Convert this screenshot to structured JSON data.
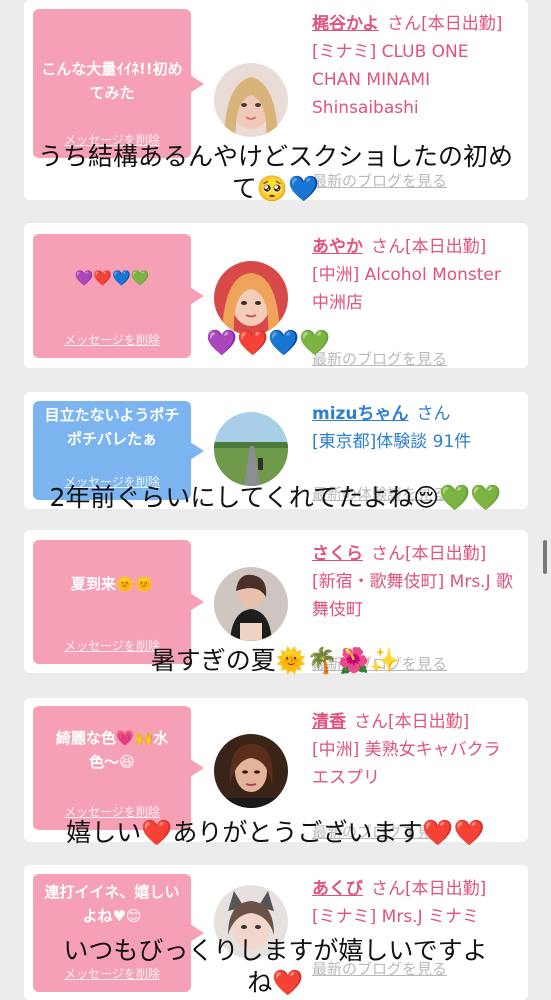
{
  "feed": {
    "delete_label": "メッセージを削除",
    "cards": [
      {
        "message": "こんな大量ｲｲﾈ!!初めてみた",
        "name": "梶谷かよ",
        "suffix": "さん[本日出勤]",
        "shop": "[ミナミ] CLUB ONE CHAN MINAMI Shinsaibashi",
        "link": "最新のブログを見る",
        "bubble_color": "#f6a0b5"
      },
      {
        "message": "💜❤️💙💚",
        "name": "あやか",
        "suffix": "さん[本日出勤]",
        "shop": "[中洲] Alcohol Monster 中洲店",
        "link": "最新のブログを見る",
        "bubble_color": "#f6a0b5"
      },
      {
        "message": "目立たないようポチポチバレたぁ",
        "name": "mizuちゃん",
        "suffix": "さん",
        "shop": "[東京都]体験談 91件",
        "link": "最新の体験談を見る",
        "bubble_color": "#7cb4ef"
      },
      {
        "message": "夏到来🌞🌞",
        "name": "さくら",
        "suffix": "さん[本日出勤]",
        "shop": "[新宿・歌舞伎町] Mrs.J 歌舞伎町",
        "link": "最新のブログを見る",
        "bubble_color": "#f6a0b5"
      },
      {
        "message": "綺麗な色💗🙌水色〜😆",
        "name": "清香",
        "suffix": "さん[本日出勤]",
        "shop": "[中洲] 美熟女キャバクラ エスプリ",
        "link": "最新のブログを見る",
        "bubble_color": "#f6a0b5"
      },
      {
        "message": "連打イイネ、嬉しいよね♥😊",
        "name": "あくび",
        "suffix": "さん[本日出勤]",
        "shop": "[ミナミ] Mrs.J ミナミ",
        "link": "最新のブログを見る",
        "bubble_color": "#f6a0b5"
      }
    ]
  },
  "overlays": [
    "うち結構あるんやけどスクショしたの初め",
    "て🥺💙",
    "💜❤️💙💚",
    "2年前ぐらいにしてくれてたよね😌💚💚",
    "暑すぎの夏🌞🌴🌺✨",
    "嬉しい❤️ありがとうございます❤️❤️",
    "いつもびっくりしますが嬉しいですよ",
    "ね❤️"
  ]
}
